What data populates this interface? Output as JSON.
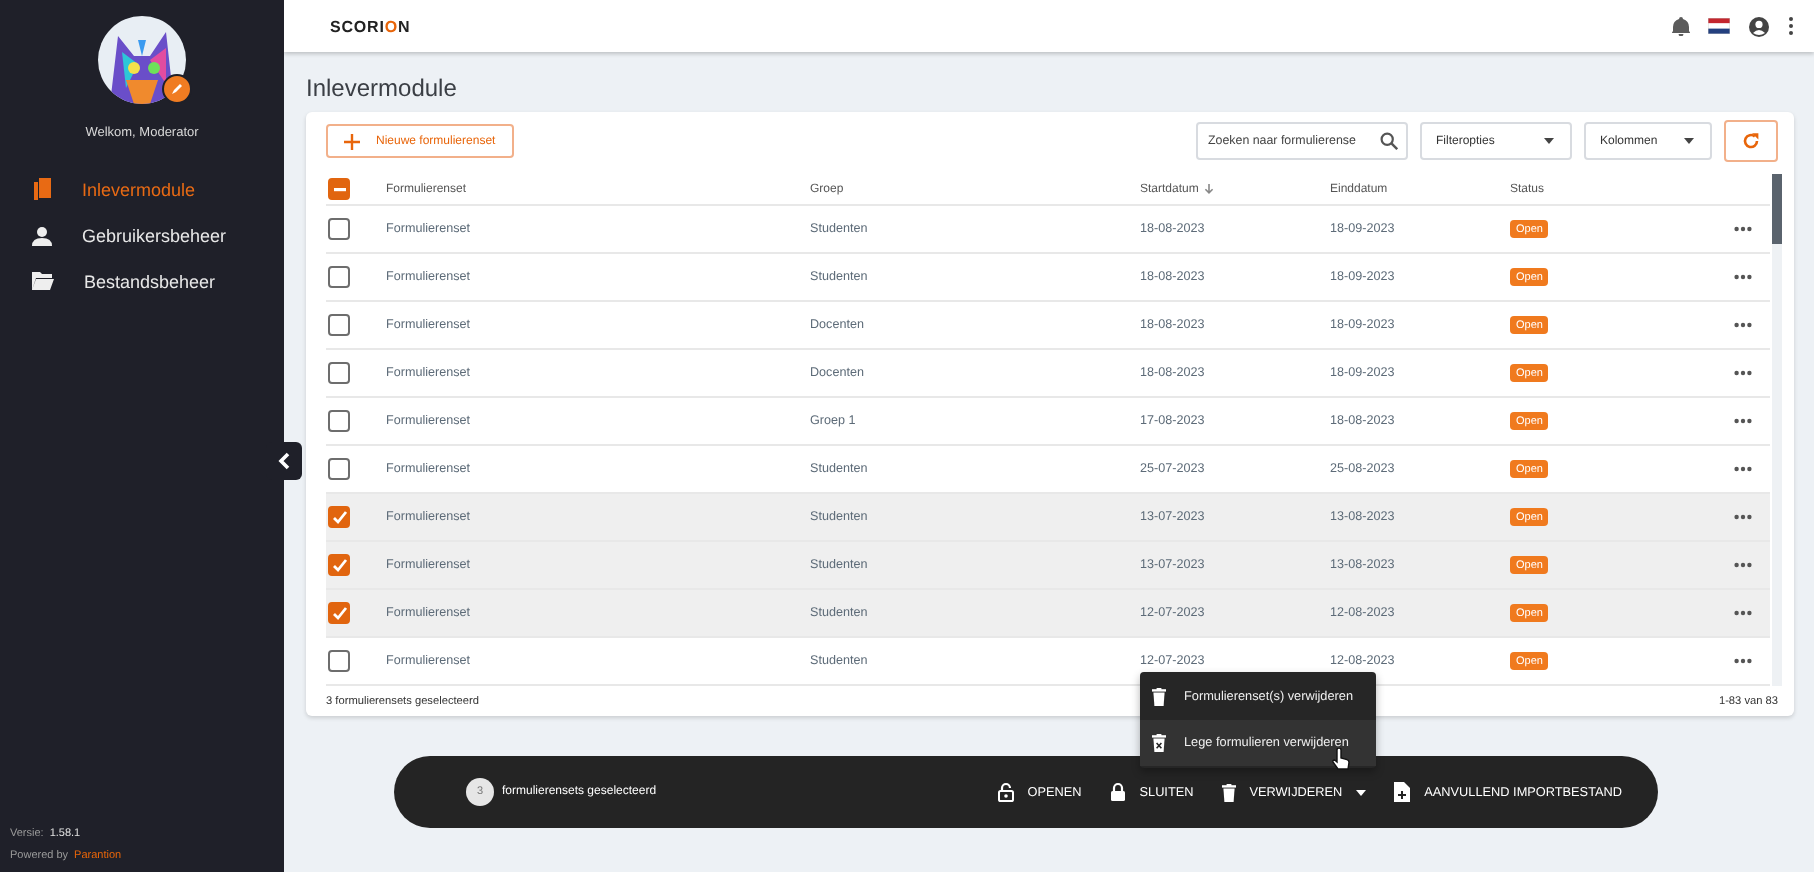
{
  "sidebar": {
    "greeting": "Welkom, Moderator",
    "items": [
      {
        "label": "Inlevermodule",
        "selected": true
      },
      {
        "label": "Gebruikersbeheer",
        "selected": false
      },
      {
        "label": "Bestandsbeheer",
        "selected": false
      }
    ],
    "version_label": "Versie:",
    "version": "1.58.1",
    "powered_by": "Powered by",
    "company": "Parantion"
  },
  "topbar": {
    "logo": {
      "before": "SCORI",
      "accent": "O",
      "after": "N"
    }
  },
  "page_title": "Inlevermodule",
  "toolbar": {
    "new_button": "Nieuwe formulierenset",
    "search": {
      "placeholder": "Zoeken naar formulierense"
    },
    "filter_button": "Filteropties",
    "columns_button": "Kolommen"
  },
  "table": {
    "header_checkbox": {
      "indeterminate": true
    },
    "columns": [
      {
        "label": "Formulierenset",
        "sorted": false
      },
      {
        "label": "Groep",
        "sorted": false
      },
      {
        "label": "Startdatum",
        "sorted": true
      },
      {
        "label": "Einddatum",
        "sorted": false
      },
      {
        "label": "Status",
        "sorted": false
      }
    ],
    "rows": [
      {
        "name": "Formulierenset",
        "group": "Studenten",
        "start": "18-08-2023",
        "end": "18-09-2023",
        "status": "Open",
        "selected": false
      },
      {
        "name": "Formulierenset",
        "group": "Studenten",
        "start": "18-08-2023",
        "end": "18-09-2023",
        "status": "Open",
        "selected": false
      },
      {
        "name": "Formulierenset",
        "group": "Docenten",
        "start": "18-08-2023",
        "end": "18-09-2023",
        "status": "Open",
        "selected": false
      },
      {
        "name": "Formulierenset",
        "group": "Docenten",
        "start": "18-08-2023",
        "end": "18-09-2023",
        "status": "Open",
        "selected": false
      },
      {
        "name": "Formulierenset",
        "group": "Groep 1",
        "start": "17-08-2023",
        "end": "18-08-2023",
        "status": "Open",
        "selected": false
      },
      {
        "name": "Formulierenset",
        "group": "Studenten",
        "start": "25-07-2023",
        "end": "25-08-2023",
        "status": "Open",
        "selected": false
      },
      {
        "name": "Formulierenset",
        "group": "Studenten",
        "start": "13-07-2023",
        "end": "13-08-2023",
        "status": "Open",
        "selected": true
      },
      {
        "name": "Formulierenset",
        "group": "Studenten",
        "start": "13-07-2023",
        "end": "13-08-2023",
        "status": "Open",
        "selected": true
      },
      {
        "name": "Formulierenset",
        "group": "Studenten",
        "start": "12-07-2023",
        "end": "12-08-2023",
        "status": "Open",
        "selected": true
      },
      {
        "name": "Formulierenset",
        "group": "Studenten",
        "start": "12-07-2023",
        "end": "12-08-2023",
        "status": "Open",
        "selected": false
      }
    ],
    "footer": {
      "selection": "3 formulierensets geselecteerd",
      "range": "1-83 van 83"
    }
  },
  "action_bar": {
    "count": "3",
    "label": "formulierensets geselecteerd",
    "actions": [
      {
        "label": "OPENEN",
        "kind": "button"
      },
      {
        "label": "SLUITEN",
        "kind": "button"
      },
      {
        "label": "VERWIJDEREN",
        "kind": "dropdown"
      },
      {
        "label": "AANVULLEND IMPORTBESTAND",
        "kind": "button"
      }
    ]
  },
  "menu": {
    "items": [
      {
        "label": "Formulierenset(s) verwijderen",
        "hovered": false
      },
      {
        "label": "Lege formulieren verwijderen",
        "hovered": true
      }
    ]
  }
}
